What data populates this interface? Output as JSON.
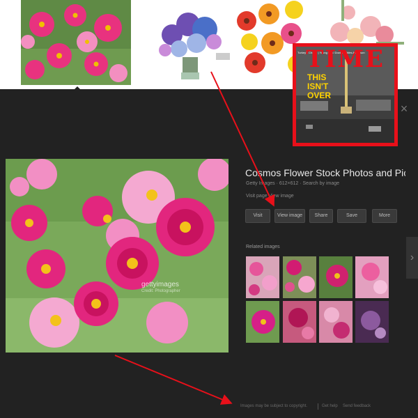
{
  "colors": {
    "panel_bg": "#222222",
    "button_bg": "#3a3a3a",
    "title_text": "#e8e8e8",
    "annotation_red": "#e8101a",
    "time_red": "#e8101a",
    "time_yellow": "#ffd300"
  },
  "viewer": {
    "title": "Cosmos Flower Stock Photos and Pic...",
    "meta": "Getty Images · 612×612 · Search by image",
    "meta2": "Visit page   View image",
    "watermark": "gettyimages",
    "watermark_sub": "Credit: Photographer",
    "close_icon": "×",
    "next_icon": "›",
    "related_label": "Related images",
    "buttons": [
      {
        "label": "Visit"
      },
      {
        "label": "View image"
      },
      {
        "label": "Share"
      },
      {
        "label": "Save"
      },
      {
        "label": "More"
      }
    ]
  },
  "footer": {
    "left": "Images may be subject to copyright.",
    "mid": "Get help",
    "right": "Send feedback"
  },
  "overlay": {
    "masthead": "TIME",
    "subline": "Turkey's Choice | Young Kids' Doctors | Wes Anderson",
    "headline_1": "THIS",
    "headline_2": "ISN'T",
    "headline_3": "OVER"
  }
}
